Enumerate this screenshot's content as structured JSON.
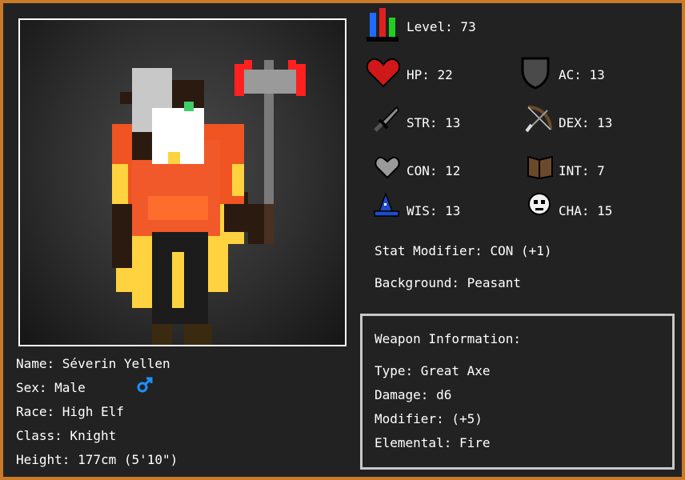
{
  "character": {
    "name_line": "Name: Séverin Yellen",
    "sex_line": "Sex: Male",
    "race_line": "Race: High Elf",
    "class_line": "Class: Knight",
    "height_line": "Height: 177cm (5'10\")"
  },
  "stats": {
    "level": "Level: 73",
    "hp": "HP: 22",
    "ac": "AC: 13",
    "str": "STR: 13",
    "dex": "DEX: 13",
    "con": "CON: 12",
    "int": "INT: 7",
    "wis": "WIS: 13",
    "cha": "CHA: 15"
  },
  "stat_modifier": "Stat Modifier: CON (+1)",
  "background": "Background: Peasant",
  "weapon": {
    "heading": "Weapon Information:",
    "type": "Type: Great Axe",
    "damage": "Damage: d6",
    "modifier": "Modifier: (+5)",
    "elemental": "Elemental: Fire"
  },
  "colors": {
    "border": "#c97a2b",
    "panel": "#222222",
    "text": "#ffffff",
    "male_symbol": "#1e90ff"
  }
}
